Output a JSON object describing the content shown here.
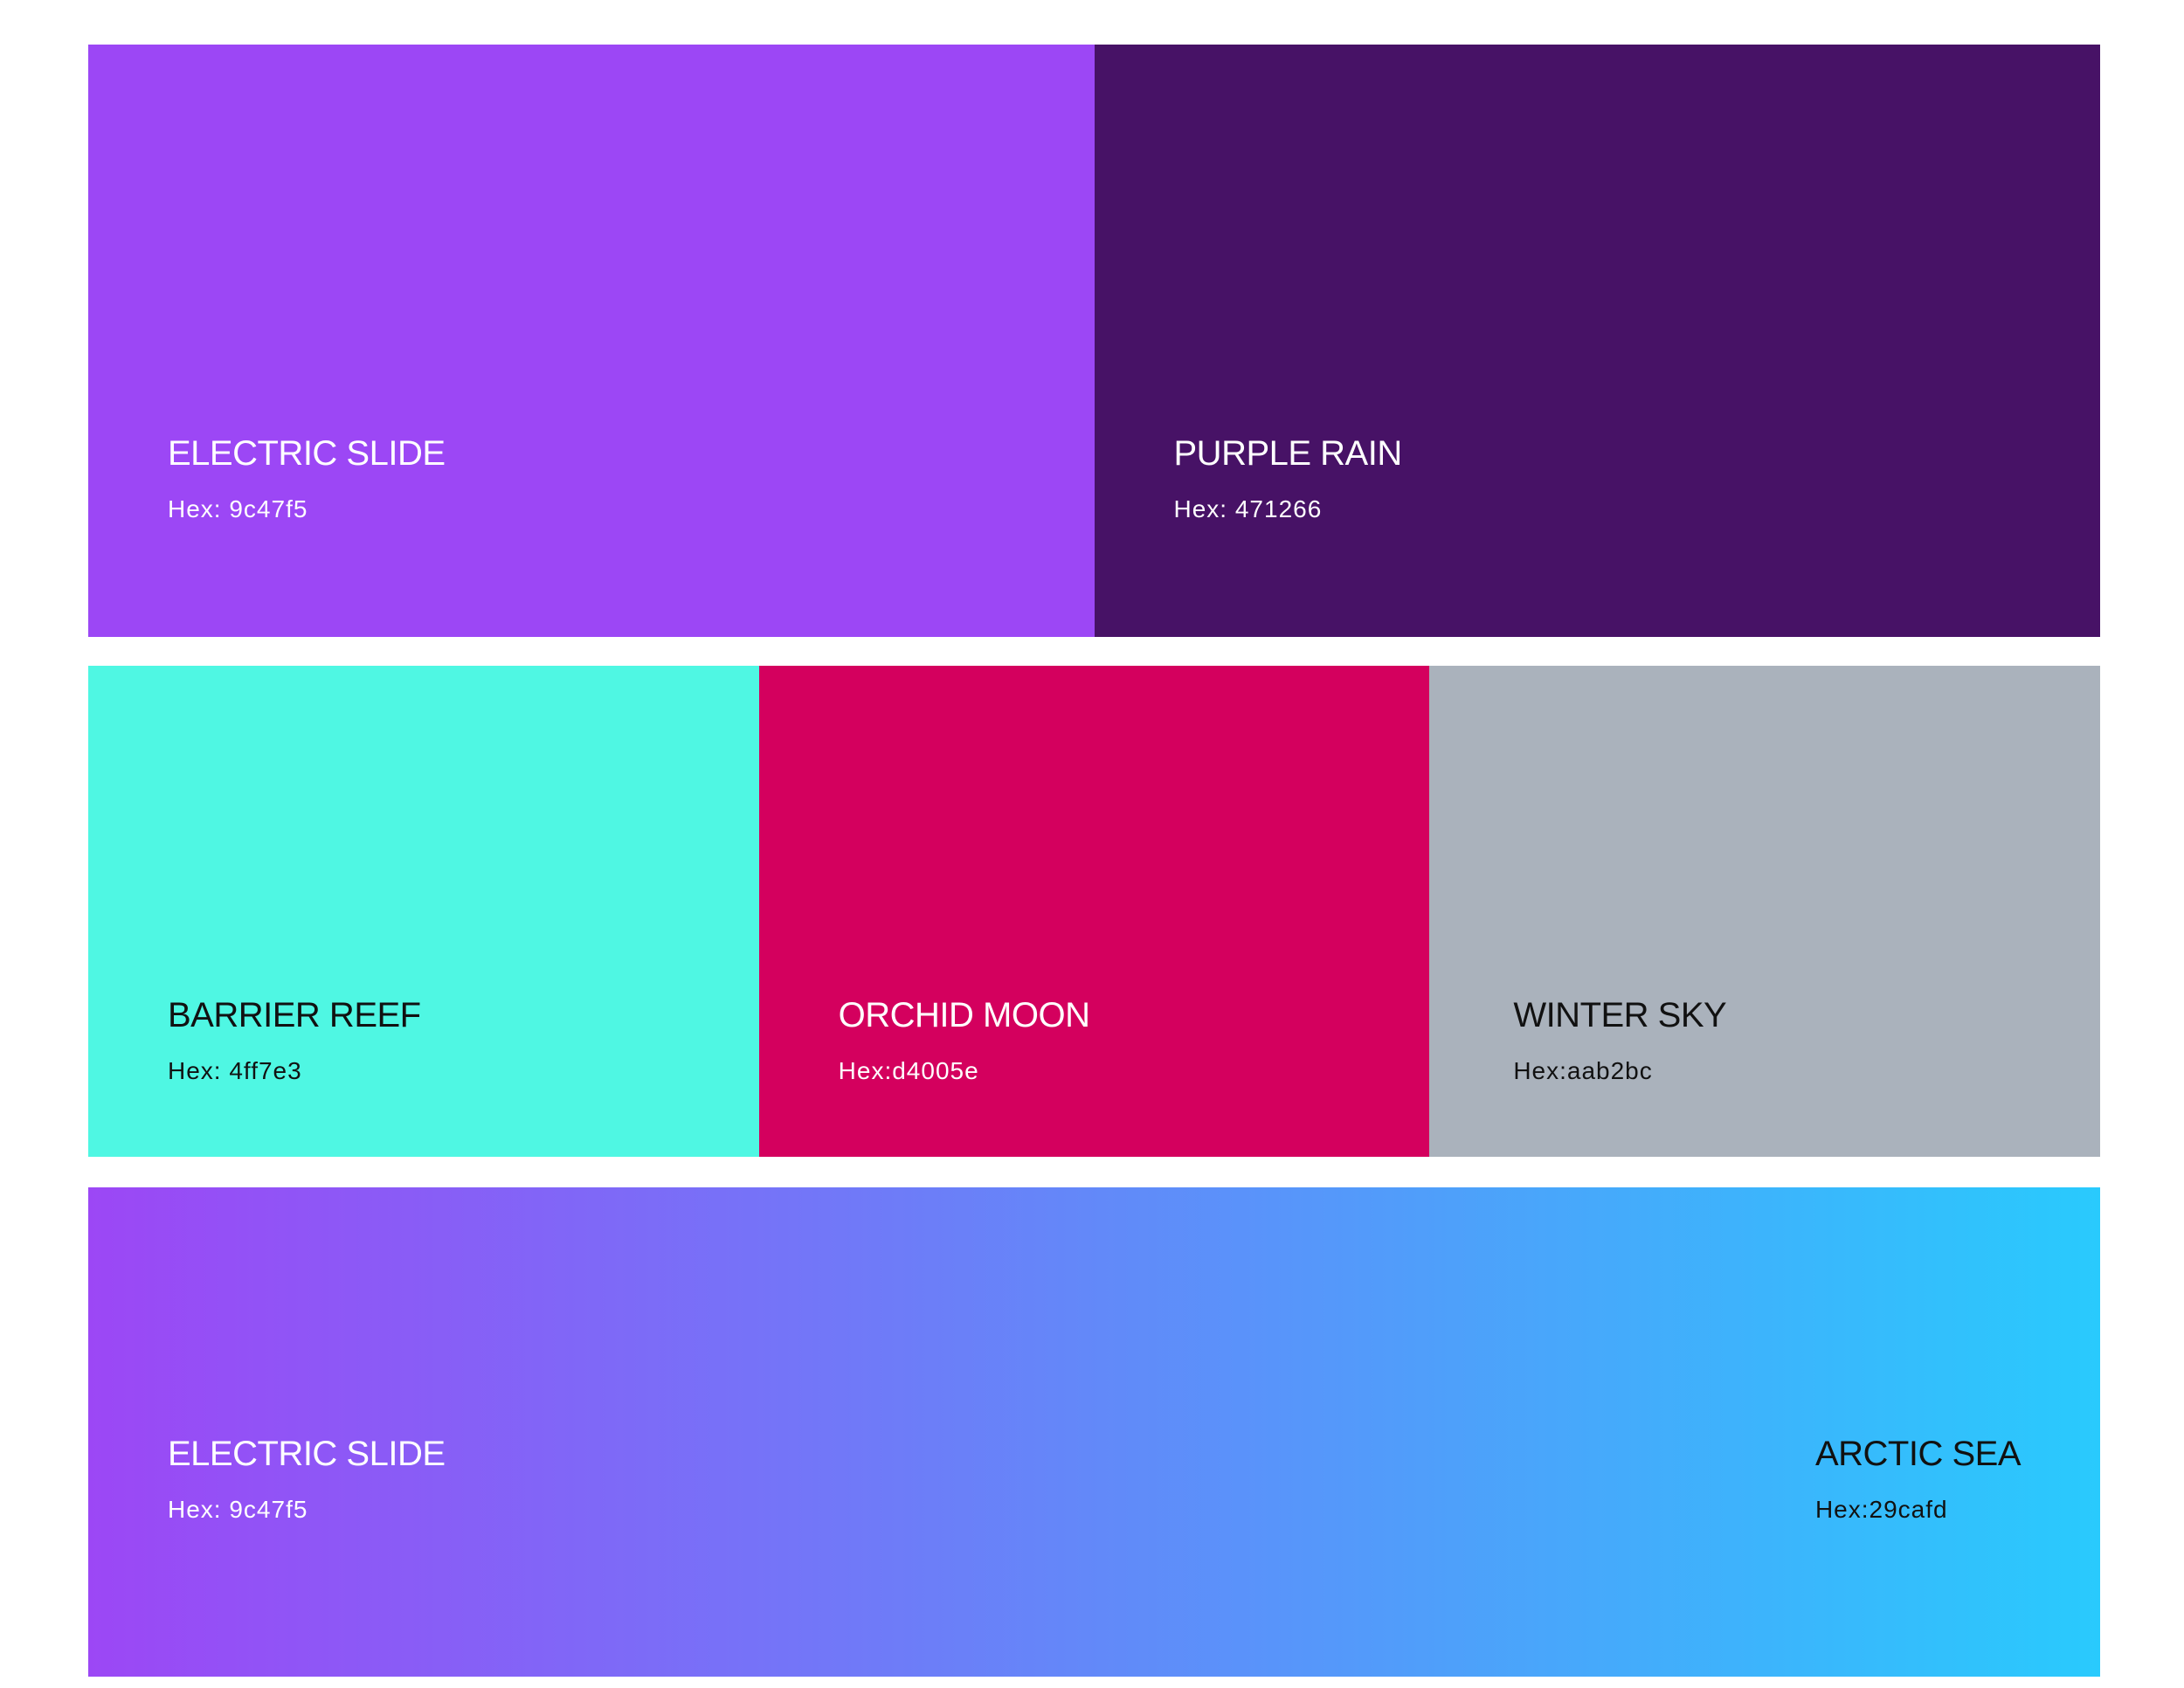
{
  "rows": [
    {
      "swatches": [
        {
          "name": "ELECTRIC SLIDE",
          "hex_label": "Hex: 9c47f5",
          "color": "#9c47f5"
        },
        {
          "name": "PURPLE RAIN",
          "hex_label": "Hex: 471266",
          "color": "#471266"
        }
      ]
    },
    {
      "swatches": [
        {
          "name": "BARRIER REEF",
          "hex_label": "Hex: 4ff7e3",
          "color": "#4ff7e3"
        },
        {
          "name": "ORCHID MOON",
          "hex_label": "Hex:d4005e",
          "color": "#d4005e"
        },
        {
          "name": "WINTER SKY",
          "hex_label": "Hex:aab2bc",
          "color": "#aab2bc"
        }
      ]
    },
    {
      "gradient": {
        "start": {
          "name": "ELECTRIC SLIDE",
          "hex_label": "Hex: 9c47f5",
          "color": "#9c47f5"
        },
        "end": {
          "name": "ARCTIC SEA",
          "hex_label": "Hex:29cafd",
          "color": "#29cafd"
        }
      }
    }
  ]
}
